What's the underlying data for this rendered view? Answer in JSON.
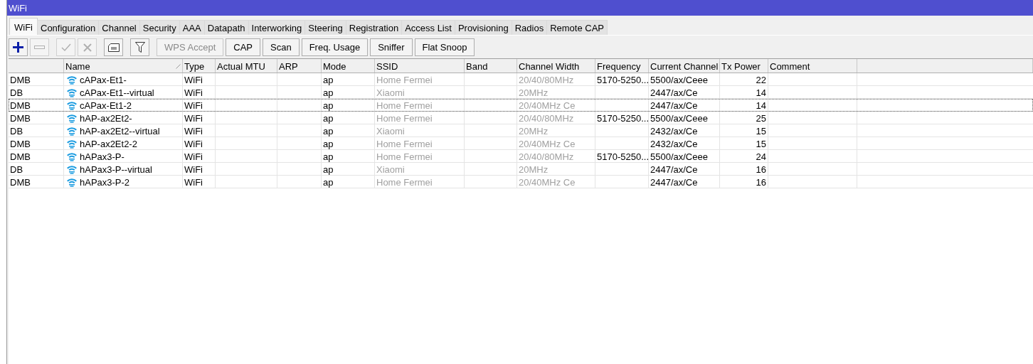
{
  "window": {
    "title": "WiFi"
  },
  "tabs": [
    {
      "label": "WiFi",
      "selected": true
    },
    {
      "label": "Configuration",
      "selected": false
    },
    {
      "label": "Channel",
      "selected": false
    },
    {
      "label": "Security",
      "selected": false
    },
    {
      "label": "AAA",
      "selected": false
    },
    {
      "label": "Datapath",
      "selected": false
    },
    {
      "label": "Interworking",
      "selected": false
    },
    {
      "label": "Steering",
      "selected": false
    },
    {
      "label": "Registration",
      "selected": false
    },
    {
      "label": "Access List",
      "selected": false
    },
    {
      "label": "Provisioning",
      "selected": false
    },
    {
      "label": "Radios",
      "selected": false
    },
    {
      "label": "Remote CAP",
      "selected": false
    }
  ],
  "toolbar": {
    "icon_buttons": [
      {
        "kind": "add",
        "disabled": false
      },
      {
        "kind": "remove",
        "disabled": true
      },
      {
        "kind": "enable",
        "disabled": true
      },
      {
        "kind": "disable",
        "disabled": true
      },
      {
        "kind": "comment",
        "disabled": false
      },
      {
        "kind": "filter",
        "disabled": false
      }
    ],
    "buttons": [
      {
        "label": "WPS Accept",
        "disabled": true
      },
      {
        "label": "CAP",
        "disabled": false
      },
      {
        "label": "Scan",
        "disabled": false
      },
      {
        "label": "Freq. Usage",
        "disabled": false
      },
      {
        "label": "Sniffer",
        "disabled": false
      },
      {
        "label": "Flat Snoop",
        "disabled": false
      }
    ]
  },
  "table": {
    "columns": [
      {
        "kind": "text"
      },
      {
        "label": "Name",
        "kind": "name",
        "sorted": true
      },
      {
        "label": "Type",
        "kind": "text"
      },
      {
        "label": "Actual MTU",
        "kind": "text"
      },
      {
        "label": "ARP",
        "kind": "text"
      },
      {
        "label": "Mode",
        "kind": "text"
      },
      {
        "label": "SSID",
        "kind": "inherited"
      },
      {
        "label": "Band",
        "kind": "text"
      },
      {
        "label": "Channel Width",
        "kind": "inherited"
      },
      {
        "label": "Frequency",
        "kind": "text"
      },
      {
        "label": "Current Channel",
        "kind": "text"
      },
      {
        "label": "Tx Power",
        "kind": "number"
      },
      {
        "label": "Comment",
        "kind": "text"
      }
    ],
    "rows": [
      {
        "selected": false,
        "cells": [
          "DMB",
          "cAPax-Et1-",
          "WiFi",
          "",
          "",
          "ap",
          "Home Fermei",
          "",
          "20/40/80MHz",
          "5170-5250...",
          "5500/ax/Ceee",
          "22",
          ""
        ]
      },
      {
        "selected": false,
        "cells": [
          "DB",
          "cAPax-Et1--virtual",
          "WiFi",
          "",
          "",
          "ap",
          "Xiaomi",
          "",
          "20MHz",
          "",
          "2447/ax/Ce",
          "14",
          ""
        ]
      },
      {
        "selected": true,
        "cells": [
          "DMB",
          "cAPax-Et1-2",
          "WiFi",
          "",
          "",
          "ap",
          "Home Fermei",
          "",
          "20/40MHz Ce",
          "",
          "2447/ax/Ce",
          "14",
          ""
        ]
      },
      {
        "selected": false,
        "cells": [
          "DMB",
          "hAP-ax2Et2-",
          "WiFi",
          "",
          "",
          "ap",
          "Home Fermei",
          "",
          "20/40/80MHz",
          "5170-5250...",
          "5500/ax/Ceee",
          "25",
          ""
        ]
      },
      {
        "selected": false,
        "cells": [
          "DB",
          "hAP-ax2Et2--virtual",
          "WiFi",
          "",
          "",
          "ap",
          "Xiaomi",
          "",
          "20MHz",
          "",
          "2432/ax/Ce",
          "15",
          ""
        ]
      },
      {
        "selected": false,
        "cells": [
          "DMB",
          "hAP-ax2Et2-2",
          "WiFi",
          "",
          "",
          "ap",
          "Home Fermei",
          "",
          "20/40MHz Ce",
          "",
          "2432/ax/Ce",
          "15",
          ""
        ]
      },
      {
        "selected": false,
        "cells": [
          "DMB",
          "hAPax3-P-",
          "WiFi",
          "",
          "",
          "ap",
          "Home Fermei",
          "",
          "20/40/80MHz",
          "5170-5250...",
          "5500/ax/Ceee",
          "24",
          ""
        ]
      },
      {
        "selected": false,
        "cells": [
          "DB",
          "hAPax3-P--virtual",
          "WiFi",
          "",
          "",
          "ap",
          "Xiaomi",
          "",
          "20MHz",
          "",
          "2447/ax/Ce",
          "16",
          ""
        ]
      },
      {
        "selected": false,
        "cells": [
          "DMB",
          "hAPax3-P-2",
          "WiFi",
          "",
          "",
          "ap",
          "Home Fermei",
          "",
          "20/40MHz Ce",
          "",
          "2447/ax/Ce",
          "16",
          ""
        ]
      }
    ]
  }
}
